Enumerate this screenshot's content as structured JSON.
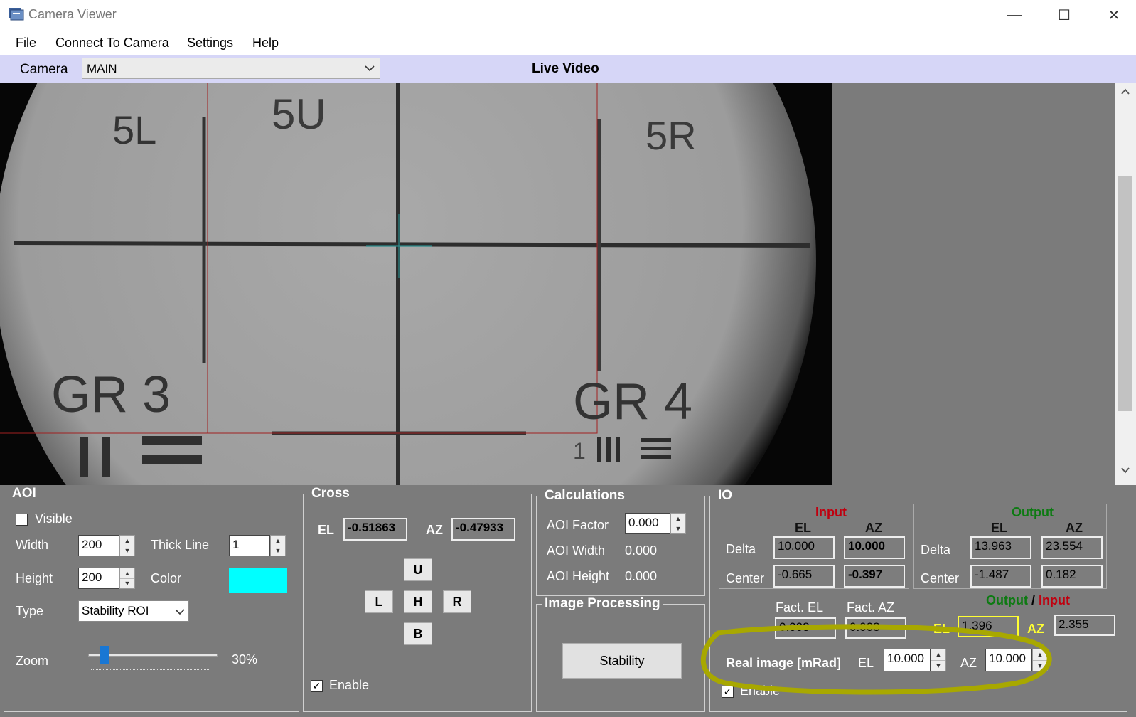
{
  "window": {
    "title": "Camera Viewer",
    "minimize": "—",
    "maximize": "☐",
    "close": "✕"
  },
  "menu": [
    "File",
    "Connect To Camera",
    "Settings",
    "Help"
  ],
  "camera_bar": {
    "label": "Camera",
    "selected": "MAIN",
    "title": "Live Video"
  },
  "video_labels": {
    "l5": "5L",
    "u5": "5U",
    "r5": "5R",
    "gr3": "GR 3",
    "gr4": "GR 4",
    "one": "1"
  },
  "aoi": {
    "legend": "AOI",
    "visible_label": "Visible",
    "visible_checked": false,
    "width_label": "Width",
    "width_value": "200",
    "height_label": "Height",
    "height_value": "200",
    "thick_line_label": "Thick Line",
    "thick_line_value": "1",
    "color_label": "Color",
    "color_hex": "#00ffff",
    "type_label": "Type",
    "type_value": "Stability ROI",
    "zoom_label": "Zoom",
    "zoom_value": "30%",
    "zoom_fraction": 0.1
  },
  "cross": {
    "legend": "Cross",
    "el_label": "EL",
    "el_value": "-0.51863",
    "az_label": "AZ",
    "az_value": "-0.47933",
    "up": "U",
    "left": "L",
    "home": "H",
    "right": "R",
    "bottom": "B",
    "enable_label": "Enable",
    "enable_checked": true
  },
  "calculations": {
    "legend": "Calculations",
    "aoi_factor_label": "AOI Factor",
    "aoi_factor_value": "0.000",
    "aoi_width_label": "AOI Width",
    "aoi_width_value": "0.000",
    "aoi_height_label": "AOI Height",
    "aoi_height_value": "0.000"
  },
  "image_processing": {
    "legend": "Image Processing",
    "stability_button": "Stability"
  },
  "io": {
    "legend": "IO",
    "input_title": "Input",
    "output_title": "Output",
    "el": "EL",
    "az": "AZ",
    "delta_label": "Delta",
    "center_label": "Center",
    "input_delta_el": "10.000",
    "input_delta_az": "10.000",
    "input_center_el": "-0.665",
    "input_center_az": "-0.397",
    "output_delta_el": "13.963",
    "output_delta_az": "23.554",
    "output_center_el": "-1.487",
    "output_center_az": "0.182",
    "fact_el_label": "Fact. EL",
    "fact_az_label": "Fact. AZ",
    "fact_el_value": "0.008",
    "fact_az_value": "0.008",
    "ratio_output": "Output",
    "ratio_sep": "/",
    "ratio_input": "Input",
    "ratio_el_value": "1.396",
    "ratio_az_value": "2.355",
    "real_image_label": "Real image [mRad]",
    "real_el_value": "10.000",
    "real_az_value": "10.000",
    "enable_label": "Enable",
    "enable_checked": true
  },
  "colors": {
    "input_red": "#c0000f",
    "output_green": "#0d7a12",
    "yellow": "#ffff33",
    "highlight": "#a8a800"
  }
}
